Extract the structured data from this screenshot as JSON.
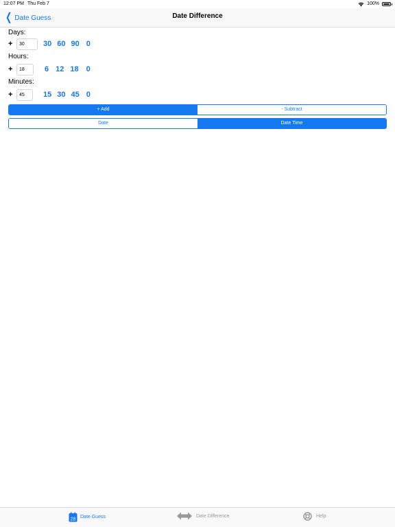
{
  "status_bar": {
    "time": "12:07 PM",
    "date": "Thu Feb 7",
    "battery": "100%",
    "battery_level": 1.0
  },
  "nav": {
    "back_label": "Date Guess",
    "title": "Date Difference"
  },
  "days": {
    "label": "Days:",
    "sign": "+",
    "value": "30",
    "quick": [
      "30",
      "60",
      "90",
      "0"
    ]
  },
  "hours": {
    "label": "Hours:",
    "sign": "+",
    "value": "18",
    "quick": [
      "6",
      "12",
      "18",
      "0"
    ]
  },
  "minutes": {
    "label": "Minutes:",
    "sign": "+",
    "value": "45",
    "quick": [
      "15",
      "30",
      "45",
      "0"
    ]
  },
  "operation": {
    "options": [
      "+ Add",
      "- Subtract"
    ],
    "selected": "+ Add"
  },
  "mode": {
    "options": [
      "Date",
      "Date Time"
    ],
    "selected": "Date Time"
  },
  "tab_bar": {
    "tabs": [
      {
        "label": "Date Guess",
        "icon": "calendar-icon",
        "icon_text": "28",
        "selected": true
      },
      {
        "label": "Date Difference",
        "icon": "double-arrow-icon",
        "selected": false
      },
      {
        "label": "Help",
        "icon": "lifebuoy-icon",
        "selected": false
      }
    ]
  },
  "colors": {
    "accent": "#1478f0",
    "inactive": "#999999"
  }
}
